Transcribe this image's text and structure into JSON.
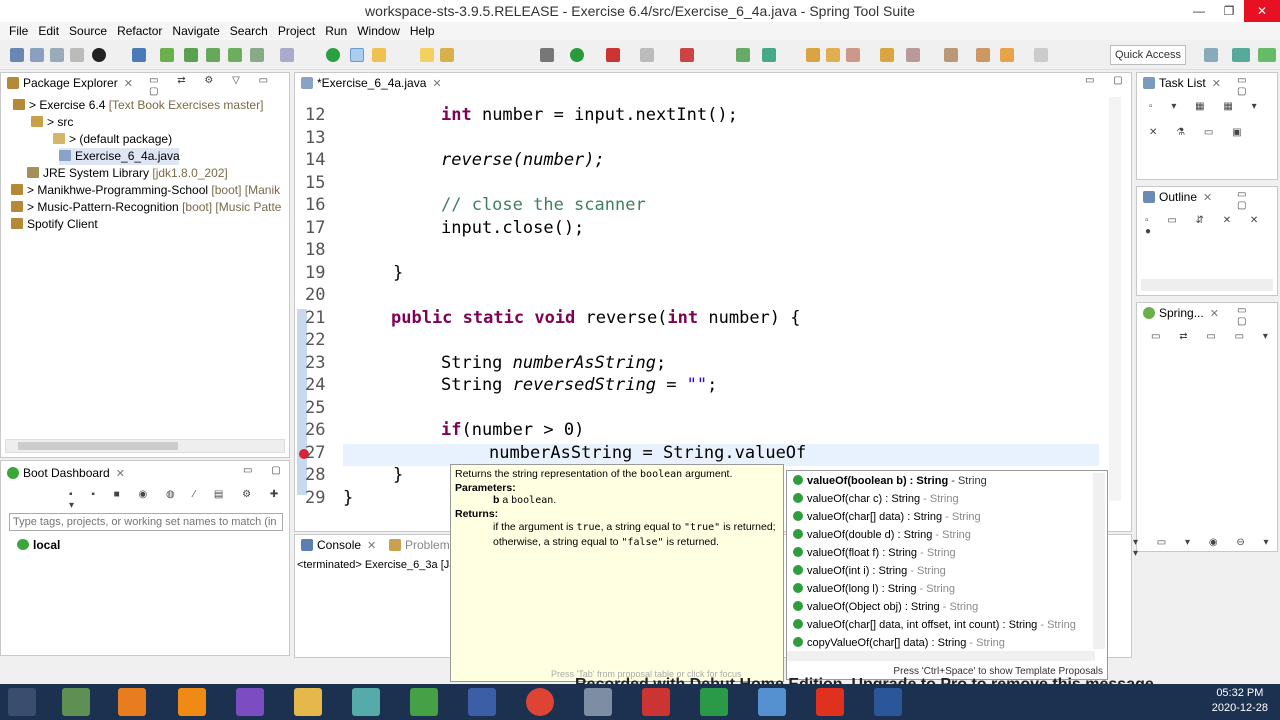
{
  "window": {
    "title": "workspace-sts-3.9.5.RELEASE - Exercise 6.4/src/Exercise_6_4a.java - Spring Tool Suite"
  },
  "menu": [
    "File",
    "Edit",
    "Source",
    "Refactor",
    "Navigate",
    "Search",
    "Project",
    "Run",
    "Window",
    "Help"
  ],
  "quick_access": "Quick Access",
  "package_explorer": {
    "tab": "Package Explorer",
    "items": [
      {
        "label": "> Exercise 6.4",
        "extra": "[Text Book Exercises master]"
      },
      {
        "label": "> src",
        "extra": ""
      },
      {
        "label": "> (default package)",
        "extra": ""
      },
      {
        "label": "Exercise_6_4a.java",
        "extra": ""
      },
      {
        "label": "JRE System Library",
        "extra": "[jdk1.8.0_202]"
      },
      {
        "label": "> Manikhwe-Programming-School",
        "extra": "[boot] [Manik"
      },
      {
        "label": "> Music-Pattern-Recognition",
        "extra": "[boot] [Music Patte"
      },
      {
        "label": "Spotify Client",
        "extra": ""
      }
    ]
  },
  "boot_dashboard": {
    "tab": "Boot Dashboard",
    "filter_placeholder": "Type tags, projects, or working set names to match (in",
    "local": "local"
  },
  "editor": {
    "tab": "*Exercise_6_4a.java",
    "lines": [
      {
        "n": "12",
        "text": "int number = input.nextInt();"
      },
      {
        "n": "13",
        "text": ""
      },
      {
        "n": "14",
        "text": "reverse(number);"
      },
      {
        "n": "15",
        "text": ""
      },
      {
        "n": "16",
        "text": "// close the scanner"
      },
      {
        "n": "17",
        "text": "input.close();"
      },
      {
        "n": "18",
        "text": ""
      },
      {
        "n": "19",
        "text": "}"
      },
      {
        "n": "20",
        "text": ""
      },
      {
        "n": "21",
        "text": "public static void reverse(int number) {"
      },
      {
        "n": "22",
        "text": ""
      },
      {
        "n": "23",
        "text": "String numberAsString;"
      },
      {
        "n": "24",
        "text": "String reversedString = \"\";"
      },
      {
        "n": "25",
        "text": ""
      },
      {
        "n": "26",
        "text": "if(number > 0)"
      },
      {
        "n": "27",
        "text": "numberAsString = String.valueOf"
      },
      {
        "n": "28",
        "text": "}"
      },
      {
        "n": "29",
        "text": "}"
      }
    ]
  },
  "console": {
    "tab": "Console",
    "tab2": "Problems",
    "status": "<terminated> Exercise_6_3a [Ja"
  },
  "task_list": {
    "tab": "Task List"
  },
  "outline": {
    "tab": "Outline"
  },
  "spring": {
    "tab": "Spring..."
  },
  "javadoc": {
    "summary_prefix": "Returns the string representation of the ",
    "summary_code": "boolean",
    "summary_suffix": " argument.",
    "params_label": "Parameters:",
    "param_b": "b",
    "param_desc_prefix": " a ",
    "param_desc_code": "boolean",
    "param_desc_suffix": ".",
    "returns_label": "Returns:",
    "returns_1": "if the argument is ",
    "returns_code_true": "true",
    "returns_2": ", a string equal to ",
    "returns_code_true2": "\"true\"",
    "returns_3": " is returned; otherwise, a string equal to ",
    "returns_code_false": "\"false\"",
    "returns_4": " is returned.",
    "footer": "Press 'Tab' from proposal table or click for focus"
  },
  "proposals": [
    {
      "sig": "valueOf(boolean b) : String",
      "ret": " - String",
      "bold": true
    },
    {
      "sig": "valueOf(char c) : String",
      "ret": " - String",
      "bold": false
    },
    {
      "sig": "valueOf(char[] data) : String",
      "ret": " - String",
      "bold": false
    },
    {
      "sig": "valueOf(double d) : String",
      "ret": " - String",
      "bold": false
    },
    {
      "sig": "valueOf(float f) : String",
      "ret": " - String",
      "bold": false
    },
    {
      "sig": "valueOf(int i) : String",
      "ret": " - String",
      "bold": false
    },
    {
      "sig": "valueOf(long l) : String",
      "ret": " - String",
      "bold": false
    },
    {
      "sig": "valueOf(Object obj) : String",
      "ret": " - String",
      "bold": false
    },
    {
      "sig": "valueOf(char[] data, int offset, int count) : String",
      "ret": " - String",
      "bold": false
    },
    {
      "sig": "copyValueOf(char[] data) : String",
      "ret": " - String",
      "bold": false
    }
  ],
  "proposals_footer": "Press 'Ctrl+Space' to show Template Proposals",
  "watermark": "Recorded with Debut Home Edition. Upgrade to Pro to remove this message.",
  "clock": {
    "time": "05:32 PM",
    "date": "2020-12-28"
  }
}
